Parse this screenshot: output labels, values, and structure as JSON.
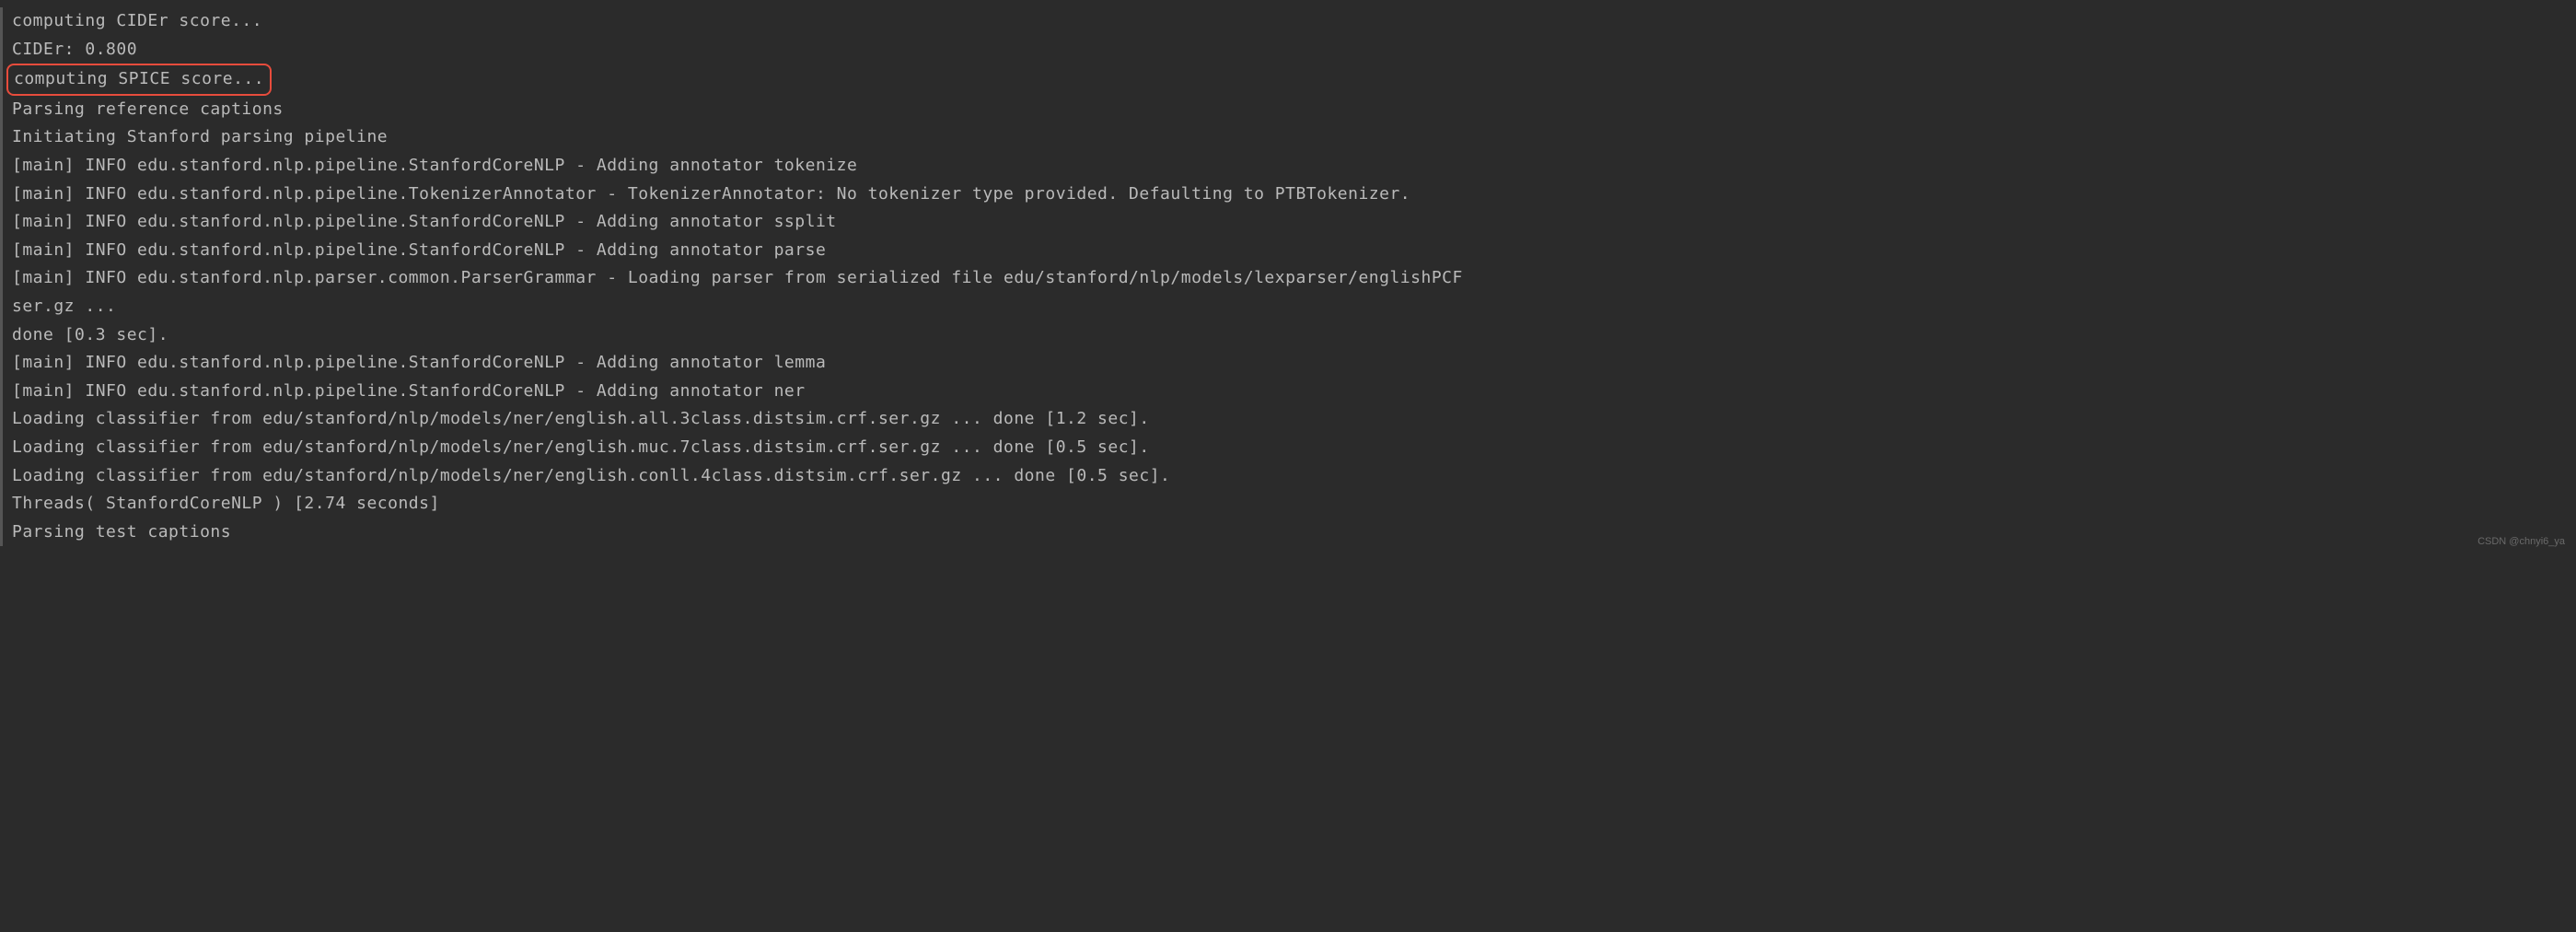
{
  "terminal": {
    "lines": [
      "computing CIDEr score...",
      "CIDEr: 0.800",
      "computing SPICE score...",
      "Parsing reference captions",
      "Initiating Stanford parsing pipeline",
      "[main] INFO edu.stanford.nlp.pipeline.StanfordCoreNLP - Adding annotator tokenize",
      "[main] INFO edu.stanford.nlp.pipeline.TokenizerAnnotator - TokenizerAnnotator: No tokenizer type provided. Defaulting to PTBTokenizer.",
      "[main] INFO edu.stanford.nlp.pipeline.StanfordCoreNLP - Adding annotator ssplit",
      "[main] INFO edu.stanford.nlp.pipeline.StanfordCoreNLP - Adding annotator parse",
      "[main] INFO edu.stanford.nlp.parser.common.ParserGrammar - Loading parser from serialized file edu/stanford/nlp/models/lexparser/englishPCF",
      "ser.gz ...",
      "done [0.3 sec].",
      "[main] INFO edu.stanford.nlp.pipeline.StanfordCoreNLP - Adding annotator lemma",
      "[main] INFO edu.stanford.nlp.pipeline.StanfordCoreNLP - Adding annotator ner",
      "Loading classifier from edu/stanford/nlp/models/ner/english.all.3class.distsim.crf.ser.gz ... done [1.2 sec].",
      "Loading classifier from edu/stanford/nlp/models/ner/english.muc.7class.distsim.crf.ser.gz ... done [0.5 sec].",
      "Loading classifier from edu/stanford/nlp/models/ner/english.conll.4class.distsim.crf.ser.gz ... done [0.5 sec].",
      "Threads( StanfordCoreNLP ) [2.74 seconds]",
      "Parsing test captions"
    ],
    "highlighted_line_index": 2
  },
  "watermark": "CSDN @chnyi6_ya"
}
